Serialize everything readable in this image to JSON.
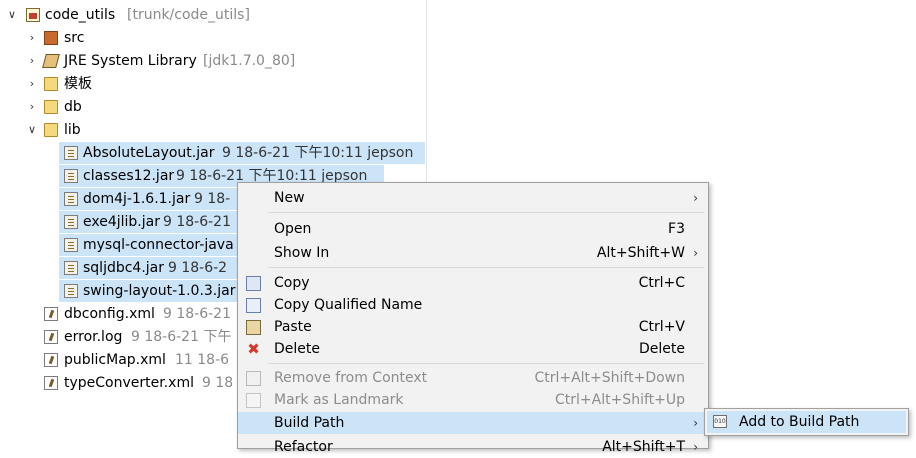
{
  "tree": {
    "project": {
      "name": "code_utils",
      "decoration": "[trunk/code_utils]"
    },
    "nodes": [
      {
        "label": "src",
        "decoration": ""
      },
      {
        "label": "JRE System Library",
        "decoration": "[jdk1.7.0_80]"
      },
      {
        "label": "模板",
        "decoration": ""
      },
      {
        "label": "db",
        "decoration": ""
      },
      {
        "label": "lib",
        "decoration": ""
      }
    ],
    "lib_files": [
      {
        "name": "AbsoluteLayout.jar",
        "meta": "9  18-6-21 下午10:11  jepson"
      },
      {
        "name": "classes12.jar",
        "meta": "9  18-6-21 下午10:11  jepson"
      },
      {
        "name": "dom4j-1.6.1.jar",
        "meta": "9  18-"
      },
      {
        "name": "exe4jlib.jar",
        "meta": "9  18-6-21"
      },
      {
        "name": "mysql-connector-java",
        "meta": ""
      },
      {
        "name": "sqljdbc4.jar",
        "meta": "9  18-6-2"
      },
      {
        "name": "swing-layout-1.0.3.jar",
        "meta": ""
      }
    ],
    "root_files": [
      {
        "name": "dbconfig.xml",
        "meta": "9  18-6-21"
      },
      {
        "name": "error.log",
        "meta": "9  18-6-21 下午"
      },
      {
        "name": "publicMap.xml",
        "meta": "11  18-6"
      },
      {
        "name": "typeConverter.xml",
        "meta": "9  18"
      }
    ]
  },
  "menu": {
    "items": [
      {
        "label": "New",
        "shortcut": "",
        "submenu": true
      },
      {
        "label": "Open",
        "shortcut": "F3",
        "submenu": false
      },
      {
        "label": "Show In",
        "shortcut": "Alt+Shift+W",
        "submenu": true
      },
      {
        "label": "Copy",
        "shortcut": "Ctrl+C",
        "submenu": false
      },
      {
        "label": "Copy Qualified Name",
        "shortcut": "",
        "submenu": false
      },
      {
        "label": "Paste",
        "shortcut": "Ctrl+V",
        "submenu": false
      },
      {
        "label": "Delete",
        "shortcut": "Delete",
        "submenu": false
      },
      {
        "label": "Remove from Context",
        "shortcut": "Ctrl+Alt+Shift+Down",
        "submenu": false,
        "disabled": true
      },
      {
        "label": "Mark as Landmark",
        "shortcut": "Ctrl+Alt+Shift+Up",
        "submenu": false,
        "disabled": true
      },
      {
        "label": "Build Path",
        "shortcut": "",
        "submenu": true,
        "highlighted": true
      },
      {
        "label": "Refactor",
        "shortcut": "Alt+Shift+T",
        "submenu": true
      }
    ],
    "submenu_arrow": "›"
  },
  "submenu": {
    "items": [
      {
        "label": "Add to Build Path",
        "icon_text": "010"
      }
    ]
  },
  "colors": {
    "selection": "#cce4f7",
    "menu_bg": "#f2f2f2",
    "decoration": "#8a8a8a",
    "delete_icon": "#d23c2e"
  }
}
